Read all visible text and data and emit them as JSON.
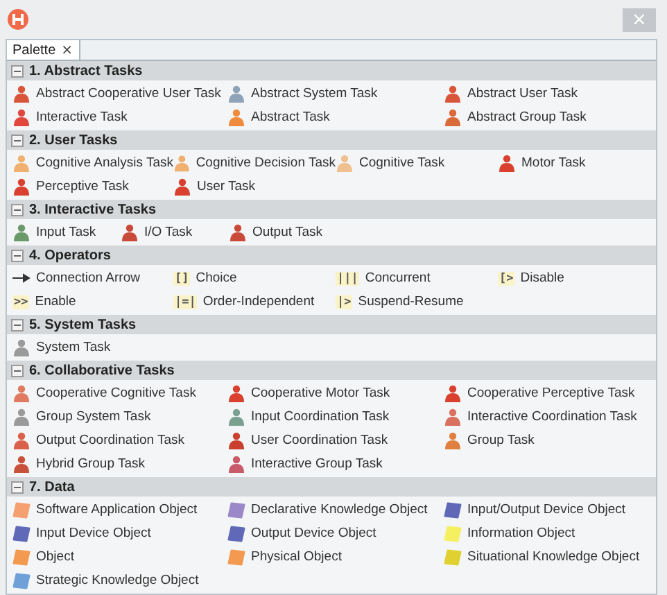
{
  "window": {
    "close": "×"
  },
  "tab": {
    "label": "Palette",
    "close": "×",
    "selected": true
  },
  "sections": [
    {
      "title": "1. Abstract Tasks",
      "expanded": true,
      "items": [
        {
          "kind": "task",
          "label": "Abstract Cooperative User Task",
          "color": "#d9553a"
        },
        {
          "kind": "task",
          "label": "Abstract System Task",
          "color": "#8fa3b8"
        },
        {
          "kind": "task",
          "label": "Abstract User Task",
          "color": "#d9553a"
        },
        {
          "kind": "task",
          "label": "Interactive Task",
          "color": "#e0473d"
        },
        {
          "kind": "task",
          "label": "Abstract Task",
          "color": "#f08a3c"
        },
        {
          "kind": "task",
          "label": "Abstract Group Task",
          "color": "#d96a3a"
        }
      ]
    },
    {
      "title": "2. User Tasks",
      "expanded": true,
      "items": [
        {
          "kind": "task",
          "label": "Cognitive Analysis Task",
          "color": "#f0b070"
        },
        {
          "kind": "task",
          "label": "Cognitive Decision Task",
          "color": "#f0b070"
        },
        {
          "kind": "task",
          "label": "Cognitive Task",
          "color": "#f0c090"
        },
        {
          "kind": "task",
          "label": "Motor Task",
          "color": "#d9402f"
        },
        {
          "kind": "task",
          "label": "Perceptive Task",
          "color": "#d9402f"
        },
        {
          "kind": "task",
          "label": "User Task",
          "color": "#d9402f"
        }
      ]
    },
    {
      "title": "3. Interactive Tasks",
      "expanded": true,
      "items": [
        {
          "kind": "task",
          "label": "Input Task",
          "color": "#6a9a6a"
        },
        {
          "kind": "task",
          "label": "I/O Task",
          "color": "#c94a3a"
        },
        {
          "kind": "task",
          "label": "Output Task",
          "color": "#c94a3a"
        }
      ]
    },
    {
      "title": "4. Operators",
      "expanded": true,
      "items": [
        {
          "kind": "arrow",
          "label": "Connection Arrow"
        },
        {
          "kind": "operator",
          "symbol": "[]",
          "label": "Choice"
        },
        {
          "kind": "operator",
          "symbol": "|||",
          "label": "Concurrent"
        },
        {
          "kind": "operator",
          "symbol": "[>",
          "label": "Disable"
        },
        {
          "kind": "operator",
          "symbol": ">>",
          "label": "Enable"
        },
        {
          "kind": "operator",
          "symbol": "|=|",
          "label": "Order-Independent"
        },
        {
          "kind": "operator",
          "symbol": "|>",
          "label": "Suspend-Resume"
        }
      ]
    },
    {
      "title": "5. System Tasks",
      "expanded": true,
      "items": [
        {
          "kind": "task",
          "label": "System Task",
          "color": "#9a9a9a"
        }
      ]
    },
    {
      "title": "6. Collaborative Tasks",
      "expanded": true,
      "items": [
        {
          "kind": "task",
          "label": "Cooperative Cognitive Task",
          "color": "#e07a60"
        },
        {
          "kind": "task",
          "label": "Cooperative Motor Task",
          "color": "#d9402f"
        },
        {
          "kind": "task",
          "label": "Cooperative Perceptive Task",
          "color": "#d9402f"
        },
        {
          "kind": "task",
          "label": "Group System Task",
          "color": "#9a9a9a"
        },
        {
          "kind": "task",
          "label": "Input Coordination Task",
          "color": "#7aa090"
        },
        {
          "kind": "task",
          "label": "Interactive Coordination Task",
          "color": "#d97060"
        },
        {
          "kind": "task",
          "label": "Output Coordination Task",
          "color": "#d9604a"
        },
        {
          "kind": "task",
          "label": "User Coordination Task",
          "color": "#c9402f"
        },
        {
          "kind": "task",
          "label": "Group Task",
          "color": "#e08040"
        },
        {
          "kind": "task",
          "label": "Hybrid Group Task",
          "color": "#c9503a"
        },
        {
          "kind": "task",
          "label": "Interactive Group Task",
          "color": "#c95a6a"
        }
      ]
    },
    {
      "title": "7. Data",
      "expanded": true,
      "items": [
        {
          "kind": "data",
          "label": "Software Application Object",
          "color": "#f4a070"
        },
        {
          "kind": "data",
          "label": "Declarative Knowledge Object",
          "color": "#9a88c8"
        },
        {
          "kind": "data",
          "label": "Input/Output Device Object",
          "color": "#6068b8"
        },
        {
          "kind": "data",
          "label": "Input Device Object",
          "color": "#6068b8"
        },
        {
          "kind": "data",
          "label": "Output Device Object",
          "color": "#6068b8"
        },
        {
          "kind": "data",
          "label": "Information Object",
          "color": "#f4f060"
        },
        {
          "kind": "data",
          "label": "Object",
          "color": "#f49a50"
        },
        {
          "kind": "data",
          "label": "Physical Object",
          "color": "#f49a50"
        },
        {
          "kind": "data",
          "label": "Situational Knowledge Object",
          "color": "#e0d030"
        },
        {
          "kind": "data",
          "label": "Strategic Knowledge Object",
          "color": "#70a0d8"
        }
      ]
    }
  ]
}
